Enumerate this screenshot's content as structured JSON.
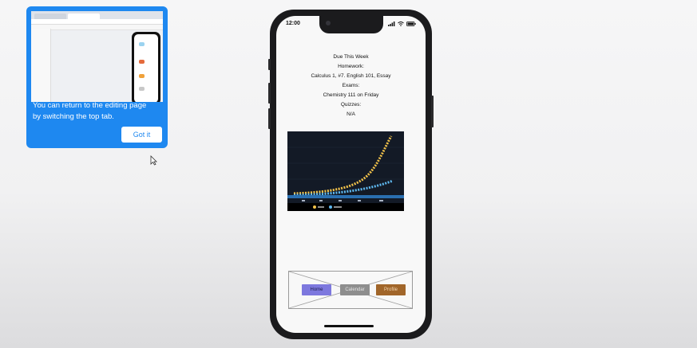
{
  "tooltip": {
    "message_line1": "You can return to the editing page",
    "message_line2": "by switching the top tab.",
    "button_label": "Got it"
  },
  "phone": {
    "status_time": "12:00",
    "lines": [
      "Due This Week",
      "Homework:",
      "Calculus 1, #7.  English 101, Essay",
      "Exams:",
      "Chemistry 111 on Friday",
      "Quizzes:",
      "N/A"
    ],
    "nav": {
      "home": "Home",
      "calendar": "Calendar",
      "profile": "Profile"
    }
  },
  "colors": {
    "tooltip_bg": "#1e88f0",
    "home_btn": "#7d78de",
    "calendar_btn": "#8e8e8e",
    "profile_btn": "#a1662a"
  }
}
